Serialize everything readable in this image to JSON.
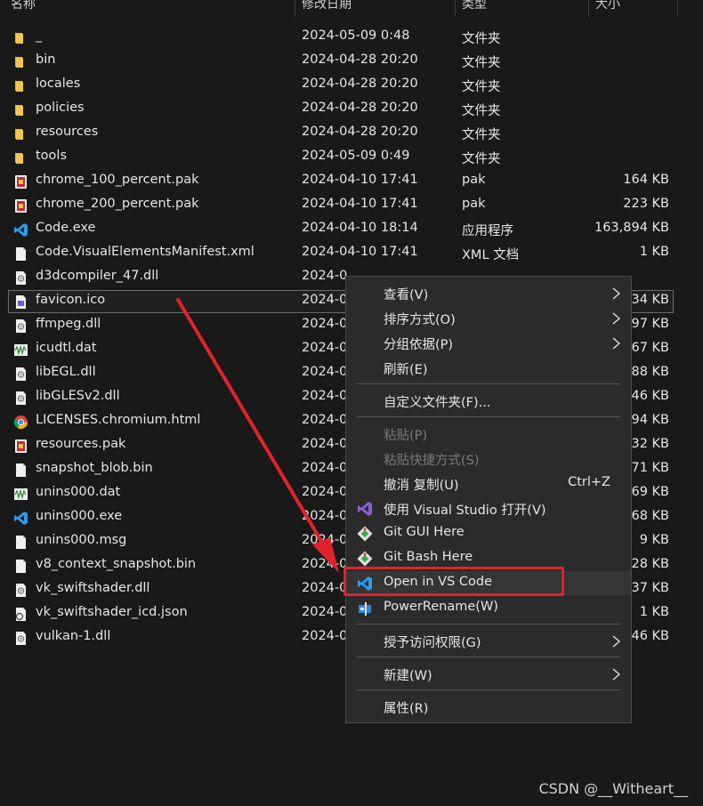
{
  "columns": {
    "name": "名称",
    "modified": "修改日期",
    "type": "类型",
    "size": "大小"
  },
  "files": [
    {
      "name": "_",
      "date": "2024-05-09 0:48",
      "type": "文件夹",
      "size": "",
      "icon": "folder-icon"
    },
    {
      "name": "bin",
      "date": "2024-04-28 20:20",
      "type": "文件夹",
      "size": "",
      "icon": "folder-icon"
    },
    {
      "name": "locales",
      "date": "2024-04-28 20:20",
      "type": "文件夹",
      "size": "",
      "icon": "folder-icon"
    },
    {
      "name": "policies",
      "date": "2024-04-28 20:20",
      "type": "文件夹",
      "size": "",
      "icon": "folder-icon"
    },
    {
      "name": "resources",
      "date": "2024-04-28 20:20",
      "type": "文件夹",
      "size": "",
      "icon": "folder-icon"
    },
    {
      "name": "tools",
      "date": "2024-05-09 0:49",
      "type": "文件夹",
      "size": "",
      "icon": "folder-icon"
    },
    {
      "name": "chrome_100_percent.pak",
      "date": "2024-04-10 17:41",
      "type": "pak",
      "size": "164 KB",
      "icon": "pak-file-icon"
    },
    {
      "name": "chrome_200_percent.pak",
      "date": "2024-04-10 17:41",
      "type": "pak",
      "size": "223 KB",
      "icon": "pak-file-icon"
    },
    {
      "name": "Code.exe",
      "date": "2024-04-10 18:14",
      "type": "应用程序",
      "size": "163,894 KB",
      "icon": "vscode-icon"
    },
    {
      "name": "Code.VisualElementsManifest.xml",
      "date": "2024-04-10 17:41",
      "type": "XML 文档",
      "size": "1 KB",
      "icon": "document-icon"
    },
    {
      "name": "d3dcompiler_47.dll",
      "date": "2024-0",
      "type": "",
      "size": "",
      "icon": "dll-icon"
    },
    {
      "name": "favicon.ico",
      "date": "2024-0",
      "type": "",
      "size": "34 KB",
      "icon": "ico-file-icon"
    },
    {
      "name": "ffmpeg.dll",
      "date": "2024-0",
      "type": "",
      "size": "97 KB",
      "icon": "dll-icon"
    },
    {
      "name": "icudtl.dat",
      "date": "2024-0",
      "type": "",
      "size": "67 KB",
      "icon": "dat-file-icon"
    },
    {
      "name": "libEGL.dll",
      "date": "2024-0",
      "type": "",
      "size": "88 KB",
      "icon": "dll-icon"
    },
    {
      "name": "libGLESv2.dll",
      "date": "2024-0",
      "type": "",
      "size": "46 KB",
      "icon": "dll-icon"
    },
    {
      "name": "LICENSES.chromium.html",
      "date": "2024-0",
      "type": "",
      "size": "94 KB",
      "icon": "chrome-icon"
    },
    {
      "name": "resources.pak",
      "date": "2024-0",
      "type": "",
      "size": "32 KB",
      "icon": "pak-file-icon"
    },
    {
      "name": "snapshot_blob.bin",
      "date": "2024-0",
      "type": "",
      "size": "71 KB",
      "icon": "document-icon"
    },
    {
      "name": "unins000.dat",
      "date": "2024-0",
      "type": "",
      "size": "69 KB",
      "icon": "dat-file-icon"
    },
    {
      "name": "unins000.exe",
      "date": "2024-0",
      "type": "",
      "size": "68 KB",
      "icon": "vscode-icon"
    },
    {
      "name": "unins000.msg",
      "date": "2024-0",
      "type": "",
      "size": "9 KB",
      "icon": "document-icon"
    },
    {
      "name": "v8_context_snapshot.bin",
      "date": "2024-0",
      "type": "",
      "size": "28 KB",
      "icon": "document-icon"
    },
    {
      "name": "vk_swiftshader.dll",
      "date": "2024-0",
      "type": "",
      "size": "37 KB",
      "icon": "dll-icon"
    },
    {
      "name": "vk_swiftshader_icd.json",
      "date": "2024-0",
      "type": "",
      "size": "1 KB",
      "icon": "json-file-icon"
    },
    {
      "name": "vulkan-1.dll",
      "date": "2024-0",
      "type": "",
      "size": "46 KB",
      "icon": "dll-icon"
    }
  ],
  "selected_file": "favicon.ico",
  "menu": {
    "view": "查看(V)",
    "sort": "排序方式(O)",
    "group": "分组依据(P)",
    "refresh": "刷新(E)",
    "customize": "自定义文件夹(F)...",
    "paste": "粘贴(P)",
    "paste_shortcut": "粘贴快捷方式(S)",
    "undo": "撤消 复制(U)",
    "undo_shortcut": "Ctrl+Z",
    "open_vs": "使用 Visual Studio 打开(V)",
    "git_gui": "Git GUI Here",
    "git_bash": "Git Bash Here",
    "open_vscode": "Open in VS Code",
    "power_rename": "PowerRename(W)",
    "grant_access": "授予访问权限(G)",
    "new": "新建(W)",
    "properties": "属性(R)"
  },
  "highlight_color": "#e0232b",
  "watermark": "CSDN @__Witheart__"
}
